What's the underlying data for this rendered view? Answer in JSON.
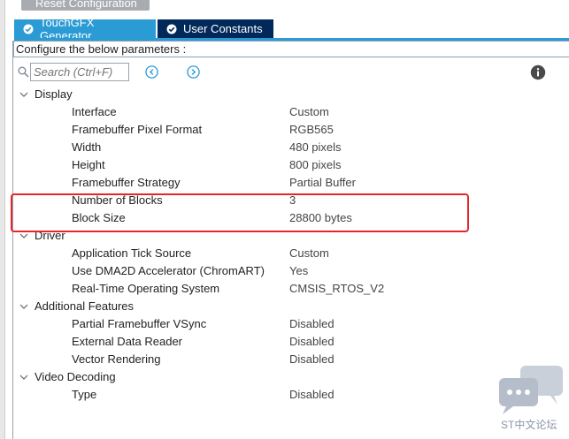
{
  "top_button": {
    "label": "Reset Configuration"
  },
  "tabs": [
    {
      "label": "TouchGFX Generator",
      "icon": "check-circle-icon",
      "active": true
    },
    {
      "label": "User Constants",
      "icon": "check-circle-icon",
      "active": false
    }
  ],
  "configure_label": "Configure the below parameters :",
  "search": {
    "placeholder": "Search (Ctrl+F)"
  },
  "categories": [
    {
      "label": "Display",
      "properties": [
        {
          "label": "Interface",
          "value": "Custom"
        },
        {
          "label": "Framebuffer Pixel Format",
          "value": "RGB565"
        },
        {
          "label": "Width",
          "value": "480 pixels"
        },
        {
          "label": "Height",
          "value": "800 pixels"
        },
        {
          "label": "Framebuffer Strategy",
          "value": "Partial Buffer"
        },
        {
          "label": "Number of Blocks",
          "value": "3"
        },
        {
          "label": "Block Size",
          "value": "28800 bytes"
        }
      ]
    },
    {
      "label": "Driver",
      "properties": [
        {
          "label": "Application Tick Source",
          "value": "Custom"
        },
        {
          "label": "Use DMA2D Accelerator (ChromART)",
          "value": "Yes"
        },
        {
          "label": "Real-Time Operating System",
          "value": "CMSIS_RTOS_V2"
        }
      ]
    },
    {
      "label": "Additional Features",
      "properties": [
        {
          "label": "Partial Framebuffer VSync",
          "value": "Disabled"
        },
        {
          "label": "External Data Reader",
          "value": "Disabled"
        },
        {
          "label": "Vector Rendering",
          "value": "Disabled"
        }
      ]
    },
    {
      "label": "Video Decoding",
      "properties": [
        {
          "label": "Type",
          "value": "Disabled"
        }
      ]
    }
  ],
  "watermark": {
    "text": "ST中文论坛"
  },
  "colors": {
    "tab_active": "#2a9bd4",
    "tab_inactive": "#00285a",
    "highlight": "#e4262a"
  }
}
